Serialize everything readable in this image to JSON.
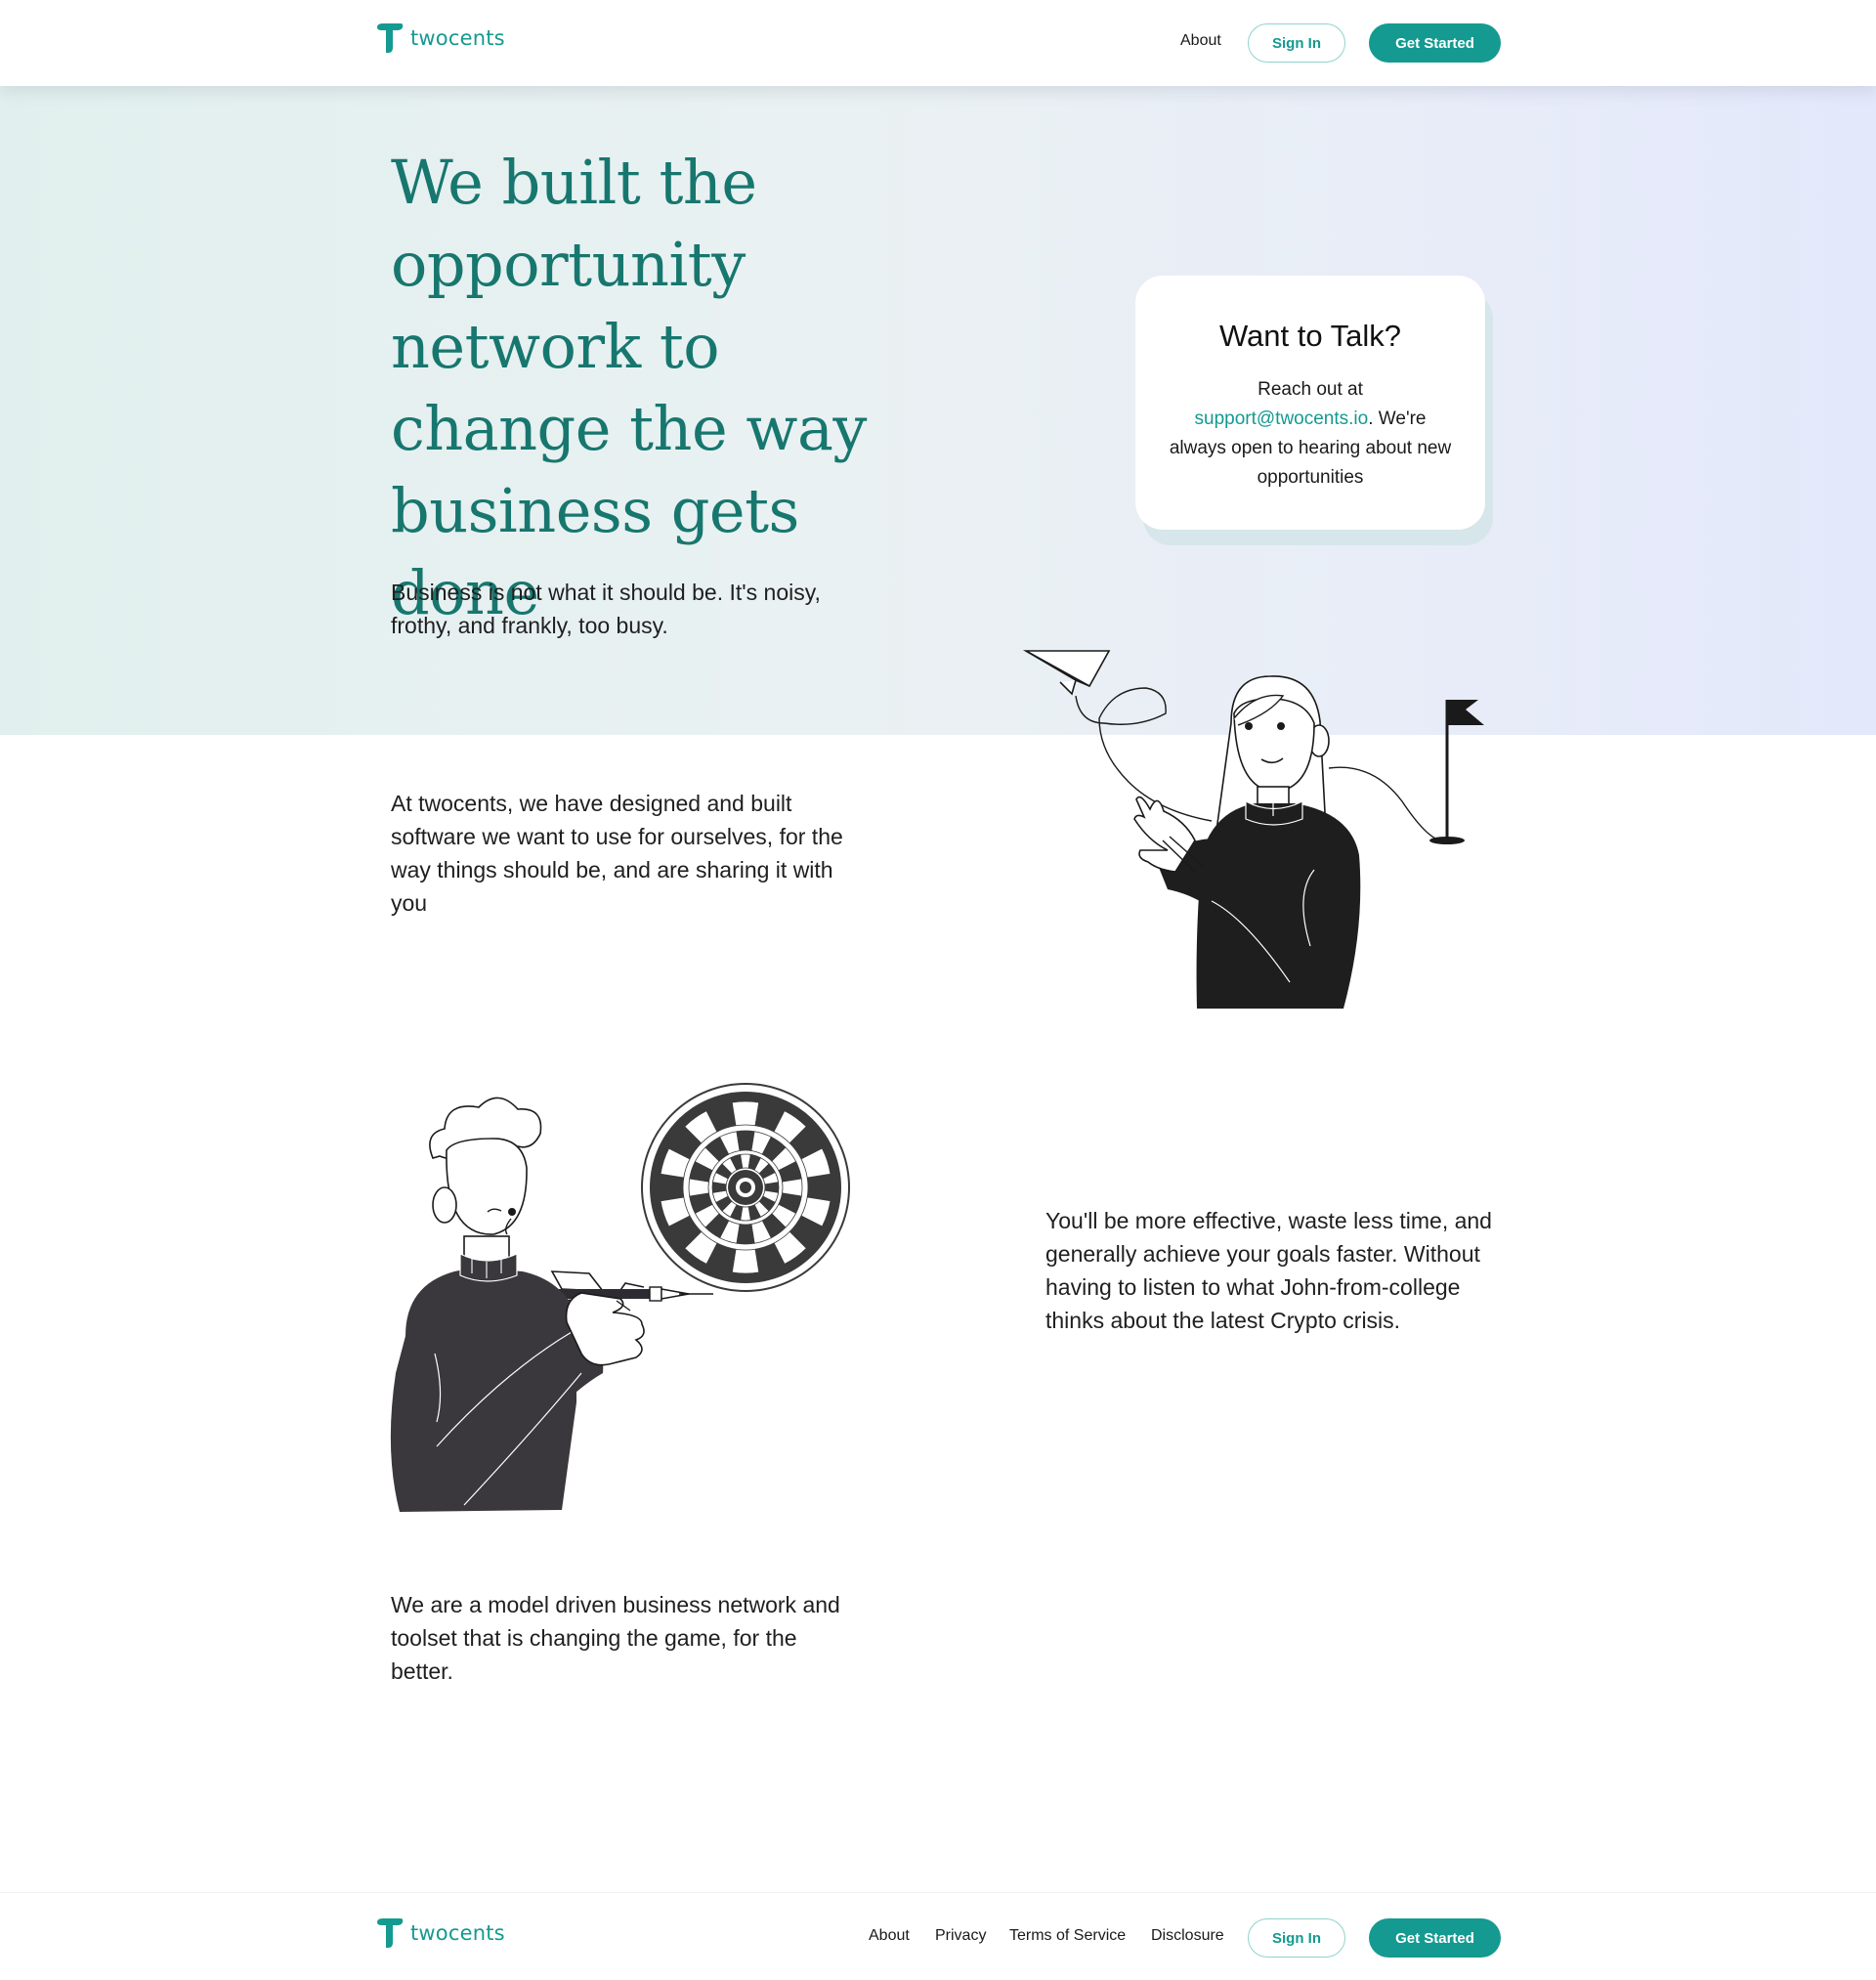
{
  "colors": {
    "brand": "#149a90",
    "heading": "#17776f",
    "hero_start": "#e1f0ee",
    "hero_end": "#e3e8fb"
  },
  "header": {
    "logo_text": "twocents",
    "nav": {
      "about": "About"
    },
    "sign_in": "Sign In",
    "get_started": "Get Started"
  },
  "hero": {
    "title": "We built the opportunity network to change the way business gets done",
    "subtitle": "Business is not what it should be. It's noisy, frothy, and frankly, too busy."
  },
  "talk_card": {
    "title": "Want to Talk?",
    "prefix": "Reach out at ",
    "email": "support@twocents.io",
    "suffix": ". We're always open to hearing about new opportunities"
  },
  "sections": {
    "built": "At twocents, we have designed and built software we want to use for ourselves, for the way things should be, and are sharing it with you",
    "effective": "You'll be more effective, waste less time, and generally achieve your goals faster. Without having to listen to what John-from-college thinks about the latest Crypto crisis.",
    "model": "We are a model driven business network and toolset that is changing the game, for the better."
  },
  "footer": {
    "logo_text": "twocents",
    "links": {
      "about": "About",
      "privacy": "Privacy",
      "terms": "Terms of Service",
      "disclosure": "Disclosure"
    },
    "sign_in": "Sign In",
    "get_started": "Get Started"
  }
}
